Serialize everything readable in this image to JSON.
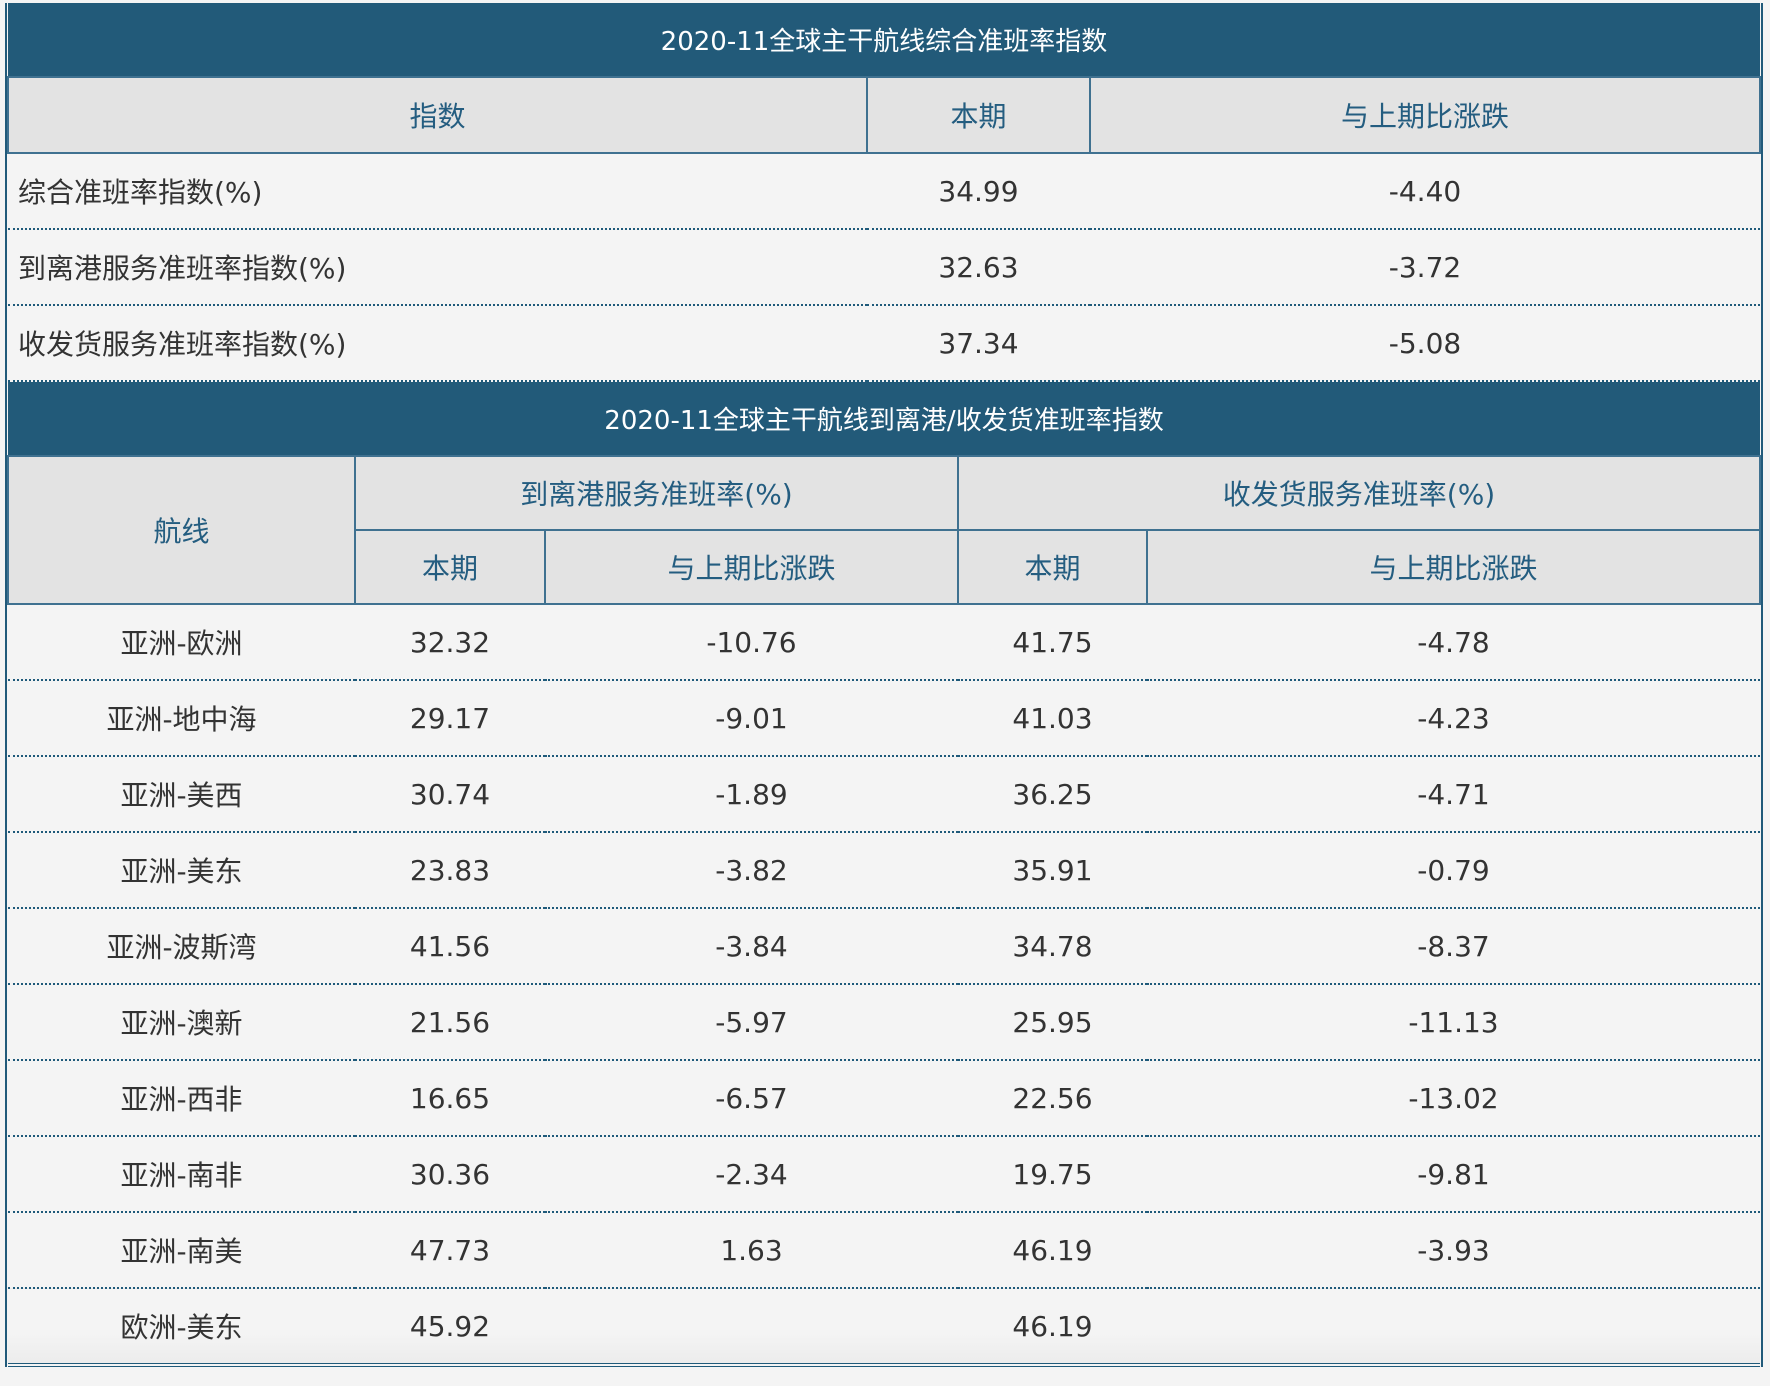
{
  "table1": {
    "title": "2020-11全球主干航线综合准班率指数",
    "headers": [
      "指数",
      "本期",
      "与上期比涨跌"
    ],
    "rows": [
      {
        "name": "综合准班率指数(%)",
        "current": "34.99",
        "change": "-4.40"
      },
      {
        "name": "到离港服务准班率指数(%)",
        "current": "32.63",
        "change": "-3.72"
      },
      {
        "name": "收发货服务准班率指数(%)",
        "current": "37.34",
        "change": "-5.08"
      }
    ]
  },
  "table2": {
    "title": "2020-11全球主干航线到离港/收发货准班率指数",
    "route_header": "航线",
    "group1_header": "到离港服务准班率(%)",
    "group2_header": "收发货服务准班率(%)",
    "sub_current": "本期",
    "sub_change": "与上期比涨跌",
    "rows": [
      {
        "route": "亚洲-欧洲",
        "port_current": "32.32",
        "port_change": "-10.76",
        "cargo_current": "41.75",
        "cargo_change": "-4.78"
      },
      {
        "route": "亚洲-地中海",
        "port_current": "29.17",
        "port_change": "-9.01",
        "cargo_current": "41.03",
        "cargo_change": "-4.23"
      },
      {
        "route": "亚洲-美西",
        "port_current": "30.74",
        "port_change": "-1.89",
        "cargo_current": "36.25",
        "cargo_change": "-4.71"
      },
      {
        "route": "亚洲-美东",
        "port_current": "23.83",
        "port_change": "-3.82",
        "cargo_current": "35.91",
        "cargo_change": "-0.79"
      },
      {
        "route": "亚洲-波斯湾",
        "port_current": "41.56",
        "port_change": "-3.84",
        "cargo_current": "34.78",
        "cargo_change": "-8.37"
      },
      {
        "route": "亚洲-澳新",
        "port_current": "21.56",
        "port_change": "-5.97",
        "cargo_current": "25.95",
        "cargo_change": "-11.13"
      },
      {
        "route": "亚洲-西非",
        "port_current": "16.65",
        "port_change": "-6.57",
        "cargo_current": "22.56",
        "cargo_change": "-13.02"
      },
      {
        "route": "亚洲-南非",
        "port_current": "30.36",
        "port_change": "-2.34",
        "cargo_current": "19.75",
        "cargo_change": "-9.81"
      },
      {
        "route": "亚洲-南美",
        "port_current": "47.73",
        "port_change": "1.63",
        "cargo_current": "46.19",
        "cargo_change": "-3.93"
      },
      {
        "route": "欧洲-美东",
        "port_current": "45.92",
        "port_change": "",
        "cargo_current": "46.19",
        "cargo_change": ""
      }
    ]
  }
}
